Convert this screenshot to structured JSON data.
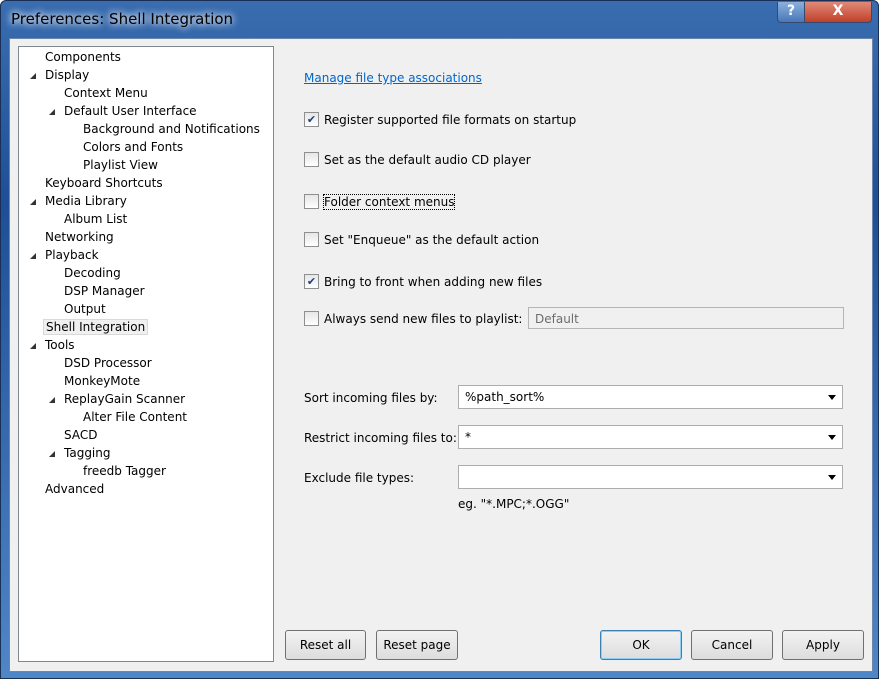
{
  "window": {
    "title": "Preferences: Shell Integration",
    "help": "?",
    "close": "X"
  },
  "tree": [
    {
      "label": "Components",
      "level": 0,
      "exp": false
    },
    {
      "label": "Display",
      "level": 0,
      "exp": true
    },
    {
      "label": "Context Menu",
      "level": 1,
      "exp": false
    },
    {
      "label": "Default User Interface",
      "level": 1,
      "exp": true
    },
    {
      "label": "Background and Notifications",
      "level": 2,
      "exp": false
    },
    {
      "label": "Colors and Fonts",
      "level": 2,
      "exp": false
    },
    {
      "label": "Playlist View",
      "level": 2,
      "exp": false
    },
    {
      "label": "Keyboard Shortcuts",
      "level": 0,
      "exp": false
    },
    {
      "label": "Media Library",
      "level": 0,
      "exp": true
    },
    {
      "label": "Album List",
      "level": 1,
      "exp": false
    },
    {
      "label": "Networking",
      "level": 0,
      "exp": false
    },
    {
      "label": "Playback",
      "level": 0,
      "exp": true
    },
    {
      "label": "Decoding",
      "level": 1,
      "exp": false
    },
    {
      "label": "DSP Manager",
      "level": 1,
      "exp": false
    },
    {
      "label": "Output",
      "level": 1,
      "exp": false
    },
    {
      "label": "Shell Integration",
      "level": 0,
      "exp": false,
      "selected": true
    },
    {
      "label": "Tools",
      "level": 0,
      "exp": true
    },
    {
      "label": "DSD Processor",
      "level": 1,
      "exp": false
    },
    {
      "label": "MonkeyMote",
      "level": 1,
      "exp": false
    },
    {
      "label": "ReplayGain Scanner",
      "level": 1,
      "exp": true
    },
    {
      "label": "Alter File Content",
      "level": 2,
      "exp": false
    },
    {
      "label": "SACD",
      "level": 1,
      "exp": false
    },
    {
      "label": "Tagging",
      "level": 1,
      "exp": true
    },
    {
      "label": "freedb Tagger",
      "level": 2,
      "exp": false
    },
    {
      "label": "Advanced",
      "level": 0,
      "exp": false
    }
  ],
  "main": {
    "link": "Manage file type associations",
    "checkboxes": [
      {
        "label": "Register supported file formats on startup",
        "checked": true
      },
      {
        "label": "Set as the default audio CD player",
        "checked": false
      },
      {
        "label": "Folder context menus",
        "checked": false
      },
      {
        "label": "Set \"Enqueue\" as the default action",
        "checked": false
      },
      {
        "label": "Bring to front when adding new files",
        "checked": true
      },
      {
        "label": "Always send new files to playlist:",
        "checked": false
      }
    ],
    "playlist_value": "Default",
    "sort_label": "Sort incoming files by:",
    "sort_value": "%path_sort%",
    "restrict_label": "Restrict incoming files to:",
    "restrict_value": "*",
    "exclude_label": "Exclude file types:",
    "exclude_value": "",
    "hint": "eg. \"*.MPC;*.OGG\""
  },
  "buttons": {
    "reset_all": "Reset all",
    "reset_page": "Reset page",
    "ok": "OK",
    "cancel": "Cancel",
    "apply": "Apply"
  }
}
